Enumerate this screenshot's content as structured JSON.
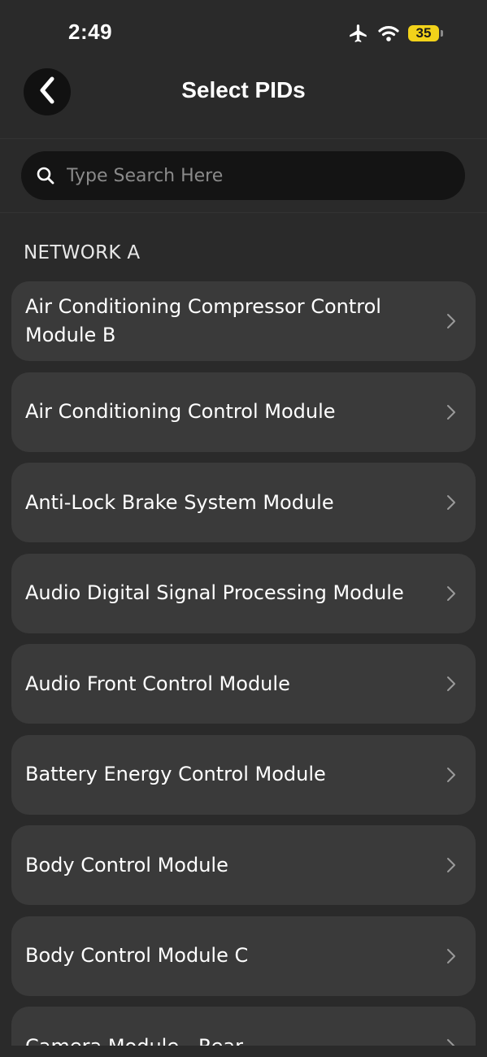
{
  "status_bar": {
    "time": "2:49",
    "battery_level": "35",
    "battery_color": "#f2d21a",
    "icons": [
      "airplane-icon",
      "wifi-icon",
      "battery-icon"
    ]
  },
  "header": {
    "title": "Select PIDs",
    "back_icon": "chevron-left-icon"
  },
  "search": {
    "placeholder": "Type Search Here",
    "value": ""
  },
  "section": {
    "label": "NETWORK A",
    "items": [
      {
        "label": "Air Conditioning Compressor Control Module B"
      },
      {
        "label": "Air Conditioning Control Module"
      },
      {
        "label": "Anti-Lock Brake System Module"
      },
      {
        "label": "Audio Digital Signal Processing Module"
      },
      {
        "label": "Audio Front Control Module"
      },
      {
        "label": "Battery Energy Control Module"
      },
      {
        "label": "Body Control Module"
      },
      {
        "label": "Body Control Module C"
      },
      {
        "label": "Camera Module - Rear"
      }
    ]
  }
}
